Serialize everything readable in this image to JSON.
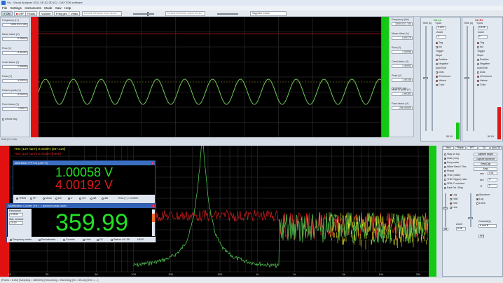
{
  "titlebar": {
    "title": "Vis - Visual Analyser 2011 XE [C] 3D (C) - DAYTON software"
  },
  "menu": [
    "File",
    "Settings",
    "Instruments",
    "Mode",
    "Saw",
    "Help"
  ],
  "toolbar": {
    "on_label": "ON",
    "off_label": "OFF",
    "buttons": [
      "Floats",
      "Volume",
      "Freq gen",
      "Video"
    ],
    "input_device": "Default Windows input device",
    "output_device": "Default Windows output device",
    "font_select": "Sapphire Kumo"
  },
  "left_panel": {
    "rows": [
      {
        "label": "Frequency (H.)",
        "value": "1000.01/1 100"
      },
      {
        "label": "Mean Value (V)",
        "value": "0.00093"
      },
      {
        "label": "Rms (V)",
        "value": "4.00192"
      },
      {
        "label": "Crest factor (V)",
        "value": "1.00055"
      },
      {
        "label": "Peak (V)",
        "value": "4.00224"
      },
      {
        "label": "Peak to peak (V)",
        "value": "4.00224"
      },
      {
        "label": "Form factor (V)",
        "value": "1.000 1"
      }
    ],
    "infinite_label": "Infinite avg"
  },
  "right_readout": {
    "rows": [
      {
        "label": "Frequency (Hz)",
        "value": "1000.01/1 100"
      },
      {
        "label": "Mean Value (V)",
        "value": "0.00179"
      },
      {
        "label": "Rms (V)",
        "value": "1.00059"
      },
      {
        "label": "Crest factor (V)",
        "value": "1.40003"
      },
      {
        "label": "Peak (V)",
        "value": "1.40145"
      },
      {
        "label": "Peak to peak (V)",
        "value": "2.80303"
      },
      {
        "label": "Form factor (V)",
        "value": "206.00000"
      }
    ],
    "infinite_label": "Infinite avg"
  },
  "ch_left": {
    "title": "Ch Lx",
    "sub1": "Time (s)",
    "sub2": "Y-pos",
    "div_value": "0.125",
    "zoom_label": "Zoom",
    "zoom_value": "1",
    "items": [
      "Trig",
      "Inv",
      "Trigger",
      "Slope",
      "Positive",
      "Negative",
      "Auto/Sub",
      "Dots",
      "XComnvol",
      "Values",
      "Color"
    ],
    "bottom": "50.0V"
  },
  "ch_right": {
    "title": "Ch Rx",
    "sub1": "Time (s)",
    "sub2": "Y-pos",
    "div_value": "0.125",
    "zoom_label": "Zoom",
    "zoom_value": "1",
    "items": [
      "Trig",
      "Inv",
      "Trigger",
      "Slope",
      "Positive",
      "Negative",
      "Auto/Sub",
      "Dots",
      "XComnvol",
      "Values",
      "Color"
    ],
    "bottom": "50.0V"
  },
  "scope_status": {
    "left": "0:00 | 1.1 Vdv",
    "right": "0:00 | 1.1 Vdv"
  },
  "spectrum": {
    "thd_line1": "THD (129 harm) 0.0038% [357.429]",
    "thd_line2": "THD (129 harm) 0.0038% [5995]",
    "x_ticks": [
      "10",
      "20",
      "50",
      "100",
      "200",
      "500",
      "1k",
      "2k",
      "5k",
      "10k",
      "20k"
    ]
  },
  "multimeter": {
    "title": "Multi Meter / FFT ch (Left / R)",
    "value1": "1.00058 V",
    "value2": "4.00192 V",
    "options": [
      "TRMS",
      "PP",
      "Mean",
      "DC",
      "V",
      "mV",
      "dB",
      "dBl",
      "Rms (+) = 0.000V"
    ],
    "color1": "#22e022",
    "color2": "#e01818"
  },
  "counter": {
    "title": "Multifunction Counter [ Hz ] - ( spectrum peak value )",
    "value": "359.99",
    "left_labels": [
      "Resolution",
      "0.01Hz",
      "Stat. window",
      "10.00"
    ],
    "options": [
      "Frequency meter",
      "Periodimeter",
      "Counter",
      "Hold",
      "DC",
      "Station UC-DE",
      "HELP"
    ],
    "color": "#22e022"
  },
  "right_tabs": [
    "Main",
    "Phase",
    "FFT",
    "Ch",
    "Auto 3D"
  ],
  "right_opts": {
    "items": [
      "Stay on top",
      "Hold (rms)",
      "Freq meter",
      "Wider Beat / Flex",
      "Phase",
      "THD (noise)",
      "THD+N(gne) ratio",
      "ZRN-C unlmted",
      "Fast Fst / Play"
    ],
    "buttons": [
      "Capture scope",
      "Capture spectrum",
      "View/Cap",
      "Amp"
    ],
    "fields": [
      {
        "label": "min",
        "value": "0.01"
      },
      {
        "label": "sec",
        "value": "4"
      },
      {
        "label": "%",
        "value": "0"
      }
    ],
    "sub_items": [
      "Log",
      "Hold",
      "Grid",
      "Line",
      "Spectrum",
      "Log",
      "Lines"
    ],
    "zoom_label": "Zoom",
    "zoom_value": "0.45",
    "channels_label": "Channel(s)",
    "channels_value": "A and B",
    "db_label": "dB",
    "fft_label": "FFT"
  },
  "statusbar": {
    "text": "[Points = 8192] [Sampling = 48000Hz] [Smoothing = Hamming] [fm = 5Kuni] [OSC = ...]"
  }
}
